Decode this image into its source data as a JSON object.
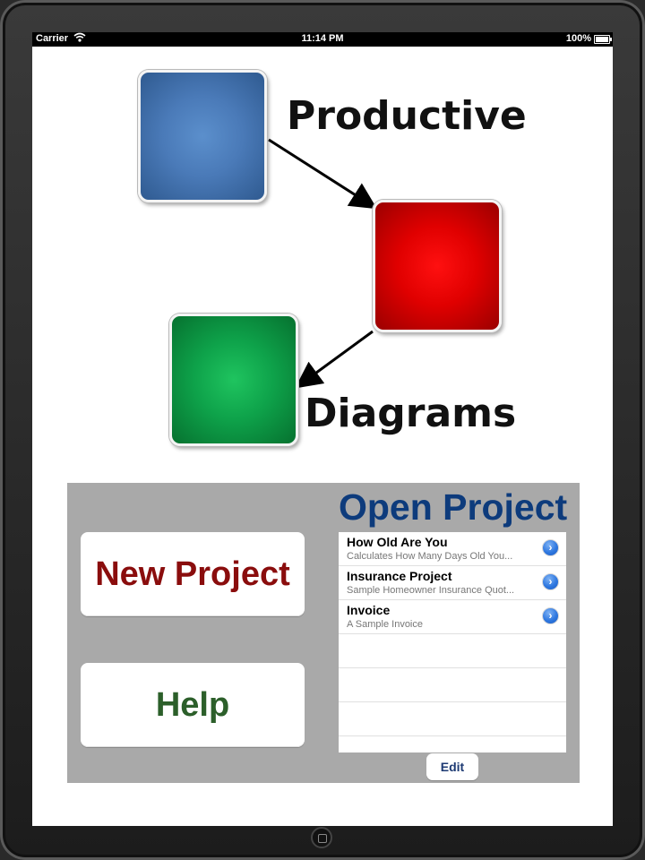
{
  "status_bar": {
    "carrier": "Carrier",
    "time": "11:14 PM",
    "battery": "100%"
  },
  "diagram": {
    "word_top": "Productive",
    "word_bottom": "Diagrams",
    "colors": {
      "blue": "#4a7ab8",
      "red": "#e00000",
      "green": "#0ea24a"
    }
  },
  "panel": {
    "new_project_label": "New Project",
    "help_label": "Help",
    "open_project_title": "Open Project",
    "projects": [
      {
        "title": "How Old Are You",
        "subtitle": "Calculates How Many Days Old You..."
      },
      {
        "title": "Insurance Project",
        "subtitle": "Sample Homeowner Insurance Quot..."
      },
      {
        "title": "Invoice",
        "subtitle": "A Sample Invoice"
      }
    ],
    "edit_label": "Edit"
  }
}
